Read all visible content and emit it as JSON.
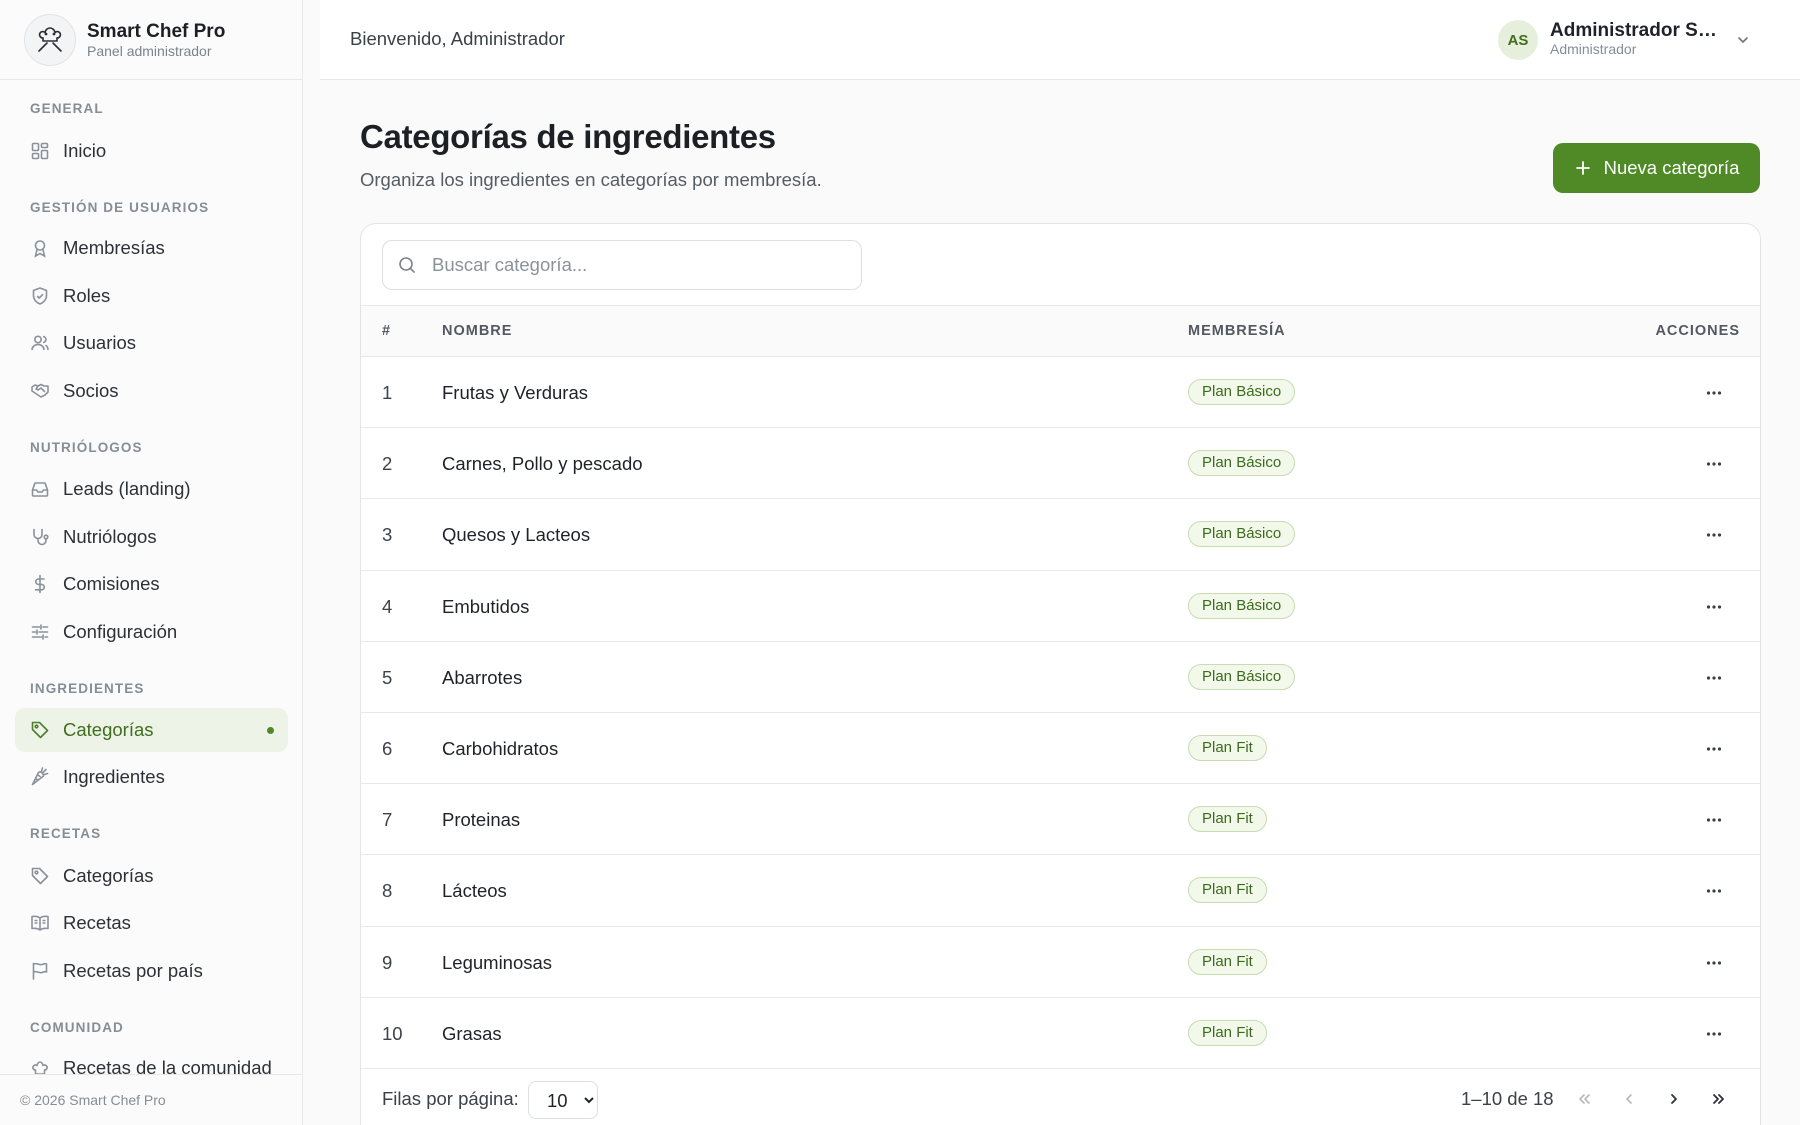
{
  "brand": {
    "title": "Smart Chef Pro",
    "subtitle": "Panel administrador",
    "logo_icon": "chef-hat-icon"
  },
  "sidebar": {
    "sections": [
      {
        "label": "GENERAL",
        "items": [
          {
            "label": "Inicio",
            "icon": "dashboard-grid-icon"
          }
        ]
      },
      {
        "label": "GESTIÓN DE USUARIOS",
        "items": [
          {
            "label": "Membresías",
            "icon": "award-icon"
          },
          {
            "label": "Roles",
            "icon": "shield-check-icon"
          },
          {
            "label": "Usuarios",
            "icon": "users-icon"
          },
          {
            "label": "Socios",
            "icon": "handshake-icon"
          }
        ]
      },
      {
        "label": "NUTRIÓLOGOS",
        "items": [
          {
            "label": "Leads (landing)",
            "icon": "inbox-icon"
          },
          {
            "label": "Nutriólogos",
            "icon": "stethoscope-icon"
          },
          {
            "label": "Comisiones",
            "icon": "dollar-icon"
          },
          {
            "label": "Configuración",
            "icon": "sliders-icon"
          }
        ]
      },
      {
        "label": "INGREDIENTES",
        "items": [
          {
            "label": "Categorías",
            "icon": "tag-icon",
            "active": true
          },
          {
            "label": "Ingredientes",
            "icon": "carrot-icon"
          }
        ]
      },
      {
        "label": "RECETAS",
        "items": [
          {
            "label": "Categorías",
            "icon": "tag-icon"
          },
          {
            "label": "Recetas",
            "icon": "book-open-icon"
          },
          {
            "label": "Recetas por país",
            "icon": "flag-icon"
          }
        ]
      },
      {
        "label": "COMUNIDAD",
        "items": [
          {
            "label": "Recetas de la comunidad",
            "icon": "chef-hat-icon"
          }
        ]
      }
    ],
    "footer": "© 2026 Smart Chef Pro"
  },
  "topbar": {
    "welcome": "Bienvenido, Administrador",
    "user_initials": "AS",
    "user_name": "Administrador Smart Chef",
    "user_name_displayed": "Administrador Sm...",
    "user_role": "Administrador"
  },
  "page": {
    "title": "Categorías de ingredientes",
    "subtitle": "Organiza los ingredientes en categorías por membresía.",
    "new_button": "Nueva categoría"
  },
  "search": {
    "placeholder": "Buscar categoría..."
  },
  "table": {
    "columns": [
      "#",
      "NOMBRE",
      "MEMBRESÍA",
      "ACCIONES"
    ],
    "rows": [
      {
        "num": "1",
        "name": "Frutas y Verduras",
        "membership": "Plan Básico"
      },
      {
        "num": "2",
        "name": "Carnes, Pollo y pescado",
        "membership": "Plan Básico"
      },
      {
        "num": "3",
        "name": "Quesos y Lacteos",
        "membership": "Plan Básico"
      },
      {
        "num": "4",
        "name": "Embutidos",
        "membership": "Plan Básico"
      },
      {
        "num": "5",
        "name": "Abarrotes",
        "membership": "Plan Básico"
      },
      {
        "num": "6",
        "name": "Carbohidratos",
        "membership": "Plan Fit"
      },
      {
        "num": "7",
        "name": "Proteinas",
        "membership": "Plan Fit"
      },
      {
        "num": "8",
        "name": "Lácteos",
        "membership": "Plan Fit"
      },
      {
        "num": "9",
        "name": "Leguminosas",
        "membership": "Plan Fit"
      },
      {
        "num": "10",
        "name": "Grasas",
        "membership": "Plan Fit"
      }
    ]
  },
  "pagination": {
    "rows_per_page_label": "Filas por página:",
    "rows_per_page": "10",
    "range": "1–10 de 18"
  },
  "colors": {
    "accent": "#4f8a26",
    "badge_bg": "#f2f8ea",
    "badge_border": "#c8dbb3",
    "active_nav_bg": "#edf3e6"
  }
}
